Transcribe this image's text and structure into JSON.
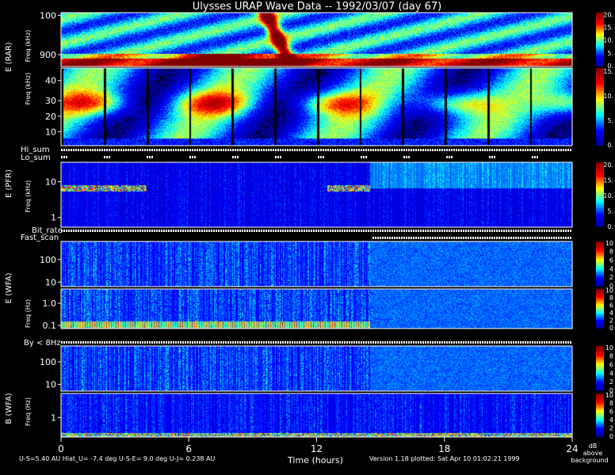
{
  "title": "Ulysses URAP Wave Data -- 1992/03/07  (day 67)",
  "x_axis": {
    "label": "Time (hours)",
    "ticks": [
      0,
      6,
      12,
      18,
      24
    ],
    "range": [
      0,
      24
    ]
  },
  "footer": {
    "orbit": "U-S=5.40 AU   Hlat_U= -7.4 deg   U-S-E=  9.0 deg   U-J= 0.238 AU",
    "version": "Version 1.18 plotted: Sat Apr 10 01:02:21 1999",
    "colorbar_units": [
      "dB",
      "above",
      "background"
    ]
  },
  "side_labels": {
    "rar": "E (RAR)",
    "pfr": "E (PFR)",
    "wfa_e": "E (WFA)",
    "wfa_b": "B (WFA)",
    "freq_khz": "Freq (kHz)",
    "freq_hz": "Freq (Hz)"
  },
  "strip_labels": {
    "hi_sum": "Hi_sum",
    "lo_sum": "Lo_sum",
    "bit_rate": "Bit_rate",
    "fast_scan": "Fast_scan",
    "by_8hz": "By < 8Hz"
  },
  "colors": {
    "background": "#000000",
    "axes": "#ffffff",
    "colormap": [
      "#00008f",
      "#0000ff",
      "#00ffff",
      "#ffff00",
      "#ff0000",
      "#800000"
    ]
  },
  "chart_data": [
    {
      "type": "heatmap",
      "name": "E (RAR)",
      "ylabel": "Freq (kHz)",
      "scale": "log",
      "yticks": [
        "100",
        "900"
      ],
      "colorbar": {
        "range": [
          0,
          20
        ],
        "ticks": [
          "0.",
          "5.",
          "10.",
          "15.",
          "20."
        ]
      }
    },
    {
      "type": "heatmap",
      "name": "E (RAR) low band",
      "ylabel": "Freq (kHz)",
      "scale": "linear",
      "yticks": [
        "10",
        "20",
        "30",
        "40"
      ],
      "colorbar": {
        "range": [
          0,
          15
        ],
        "ticks": [
          "0.",
          "5.",
          "10.",
          "15."
        ]
      }
    },
    {
      "type": "heatmap",
      "name": "E (PFR)",
      "ylabel": "Freq (kHz)",
      "scale": "log",
      "yticks": [
        "1",
        "10"
      ],
      "colorbar": {
        "range": [
          0,
          20
        ],
        "ticks": [
          "0.",
          "5.",
          "10.",
          "15.",
          "20."
        ]
      }
    },
    {
      "type": "heatmap",
      "name": "E (WFA) high",
      "ylabel": "Freq (Hz)",
      "scale": "log",
      "yticks": [
        "10",
        "100"
      ],
      "colorbar": {
        "range": [
          0,
          10
        ],
        "ticks": [
          "0",
          "2",
          "4",
          "6",
          "8",
          "10"
        ]
      }
    },
    {
      "type": "heatmap",
      "name": "E (WFA) low",
      "ylabel": "Freq (Hz)",
      "scale": "log",
      "yticks": [
        "0.1",
        "1.0"
      ],
      "colorbar": {
        "range": [
          0,
          10
        ],
        "ticks": [
          "0",
          "2",
          "4",
          "6",
          "8",
          "10"
        ]
      }
    },
    {
      "type": "heatmap",
      "name": "B (WFA) high",
      "ylabel": "Freq (Hz)",
      "scale": "log",
      "yticks": [
        "10",
        "100"
      ],
      "colorbar": {
        "range": [
          0,
          10
        ],
        "ticks": [
          "0",
          "2",
          "4",
          "6",
          "8",
          "10"
        ]
      }
    },
    {
      "type": "heatmap",
      "name": "B (WFA) low",
      "ylabel": "Freq (Hz)",
      "scale": "log",
      "yticks": [
        "1"
      ],
      "colorbar": {
        "range": [
          0,
          10
        ],
        "ticks": [
          "0",
          "2",
          "4",
          "6",
          "8",
          "10"
        ]
      }
    }
  ]
}
